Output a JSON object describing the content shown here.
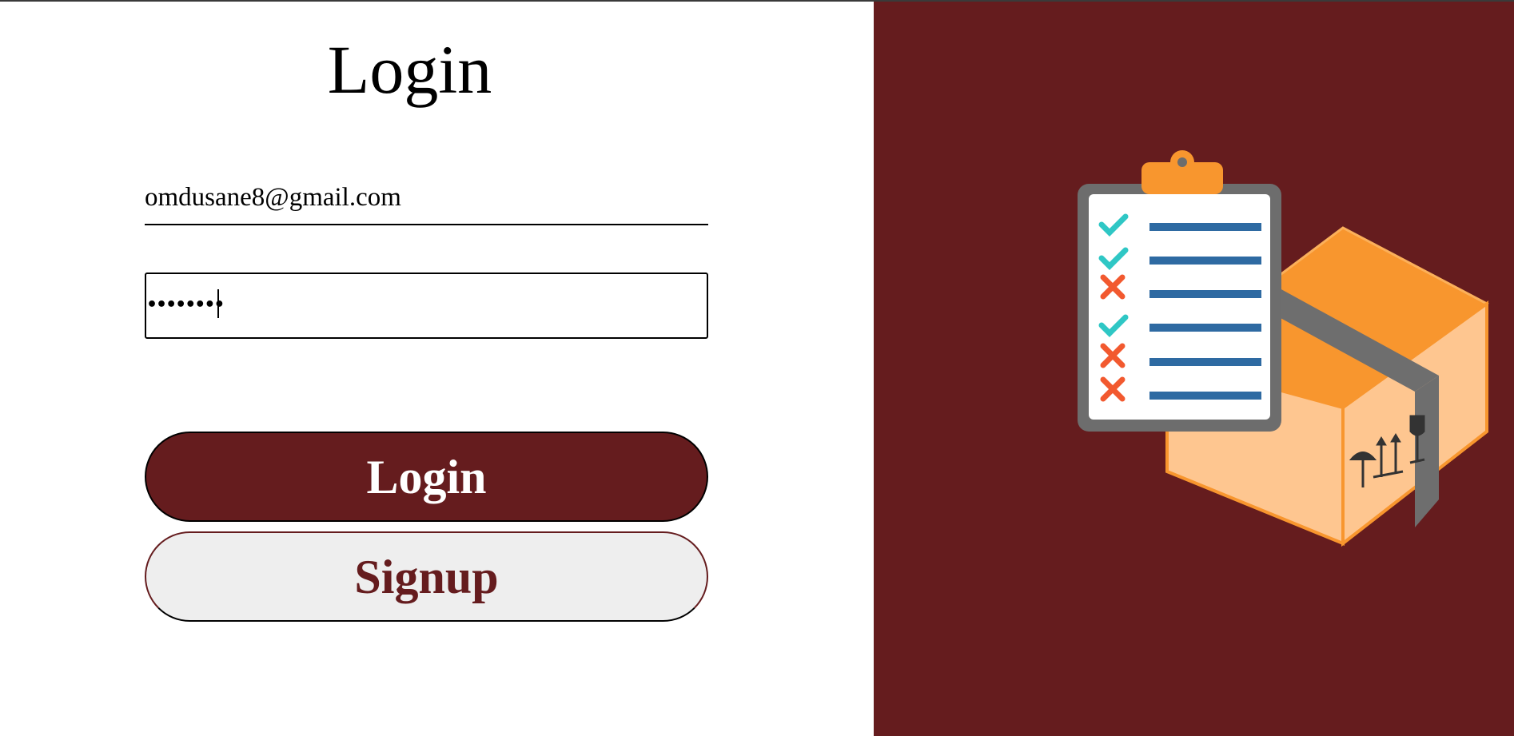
{
  "page": {
    "title": "Login"
  },
  "form": {
    "email_value": "omdusane8@gmail.com",
    "password_masked": "••••••••",
    "login_label": "Login",
    "signup_label": "Signup"
  },
  "theme": {
    "brand_color": "#651c1e",
    "signup_bg": "#eeeeee"
  },
  "illustration": {
    "icon": "clipboard-checklist-with-shipping-box"
  }
}
